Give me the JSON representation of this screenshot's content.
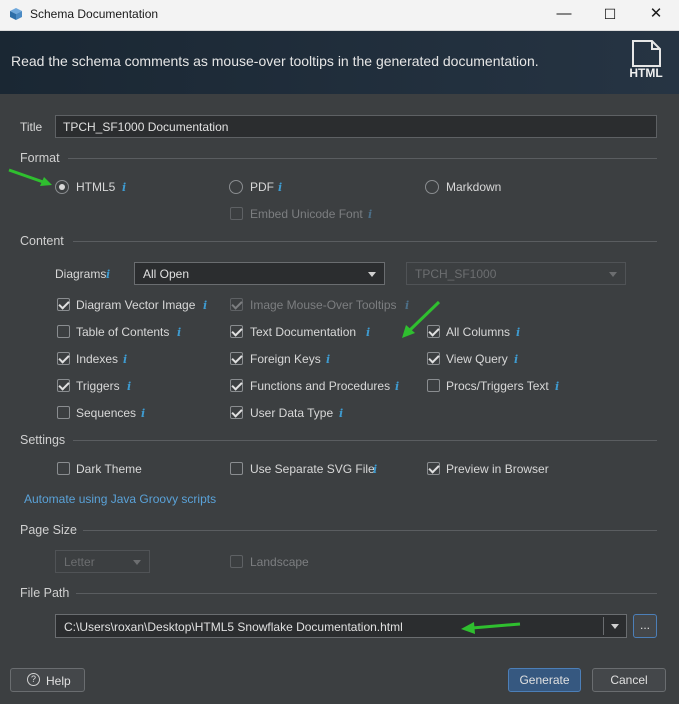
{
  "window": {
    "title": "Schema Documentation",
    "controls": {
      "minimize": "—",
      "maximize": "☐",
      "close": "✕"
    }
  },
  "banner": {
    "text": "Read the schema comments as mouse-over tooltips in the generated documentation.",
    "icon_label": "HTML"
  },
  "title_field": {
    "label": "Title",
    "value": "TPCH_SF1000 Documentation"
  },
  "format": {
    "section": "Format",
    "options": [
      {
        "label": "HTML5",
        "selected": true
      },
      {
        "label": "PDF",
        "selected": false
      },
      {
        "label": "Markdown",
        "selected": false
      }
    ],
    "embed_unicode_font": {
      "label": "Embed Unicode Font",
      "checked": false,
      "enabled": false
    }
  },
  "content": {
    "section": "Content",
    "diagrams_label": "Diagrams",
    "diagrams_value": "All Open",
    "schema_value": "TPCH_SF1000",
    "checkboxes": {
      "diagram_vector_image": {
        "label": "Diagram Vector Image",
        "checked": true
      },
      "image_mouse_over_tooltips": {
        "label": "Image Mouse-Over Tooltips",
        "checked": true,
        "enabled": false
      },
      "table_of_contents": {
        "label": "Table of Contents",
        "checked": false
      },
      "text_documentation": {
        "label": "Text Documentation",
        "checked": true
      },
      "all_columns": {
        "label": "All Columns",
        "checked": true
      },
      "indexes": {
        "label": "Indexes",
        "checked": true
      },
      "foreign_keys": {
        "label": "Foreign Keys",
        "checked": true
      },
      "view_query": {
        "label": "View Query",
        "checked": true
      },
      "triggers": {
        "label": "Triggers",
        "checked": true
      },
      "functions_and_procedures": {
        "label": "Functions and Procedures",
        "checked": true
      },
      "procs_triggers_text": {
        "label": "Procs/Triggers Text",
        "checked": false
      },
      "sequences": {
        "label": "Sequences",
        "checked": false
      },
      "user_data_type": {
        "label": "User Data Type",
        "checked": true
      }
    }
  },
  "settings": {
    "section": "Settings",
    "dark_theme": {
      "label": "Dark Theme",
      "checked": false
    },
    "separate_svg": {
      "label": "Use Separate SVG File",
      "checked": false
    },
    "preview_browser": {
      "label": "Preview in Browser",
      "checked": true
    },
    "groovy_link": "Automate using Java Groovy scripts"
  },
  "page_size": {
    "section": "Page Size",
    "size_value": "Letter",
    "landscape": {
      "label": "Landscape",
      "checked": false
    }
  },
  "file_path": {
    "section": "File Path",
    "value": "C:\\Users\\roxan\\Desktop\\HTML5 Snowflake Documentation.html",
    "browse_label": "..."
  },
  "footer": {
    "help": "Help",
    "generate": "Generate",
    "cancel": "Cancel"
  },
  "info_glyph": "i",
  "colors": {
    "accent": "#365880",
    "info": "#3e9bd0",
    "annotation_arrow": "#2fbf2f",
    "background": "#3c3f41"
  }
}
